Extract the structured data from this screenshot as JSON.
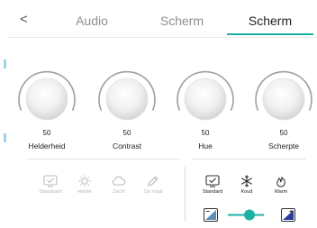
{
  "header": {
    "back_glyph": "<",
    "tabs": [
      {
        "label": "Audio",
        "active": false
      },
      {
        "label": "Scherm",
        "active": false
      },
      {
        "label": "Scherm",
        "active": true
      }
    ],
    "accent_color": "#1bb3a4"
  },
  "knobs": [
    {
      "label": "Helderheid",
      "value": "50"
    },
    {
      "label": "Contrast",
      "value": "50"
    },
    {
      "label": "Hue",
      "value": "50"
    },
    {
      "label": "Scherpte",
      "value": "50"
    }
  ],
  "picture_modes": [
    {
      "label": "Standaard",
      "icon": "monitor-check-icon"
    },
    {
      "label": "Helder",
      "icon": "sun-icon"
    },
    {
      "label": "Zacht",
      "icon": "cloud-icon"
    },
    {
      "label": "Op maat",
      "icon": "pencil-icon"
    }
  ],
  "color_temps": [
    {
      "label": "Standard",
      "icon": "monitor-check-icon"
    },
    {
      "label": "Koud",
      "icon": "snowflake-icon"
    },
    {
      "label": "Warm",
      "icon": "flame-icon"
    }
  ],
  "blue_light_slider": {
    "value_fraction": 0.6,
    "min_icon": "low-blue-light-icon",
    "max_icon": "high-blue-light-icon"
  }
}
